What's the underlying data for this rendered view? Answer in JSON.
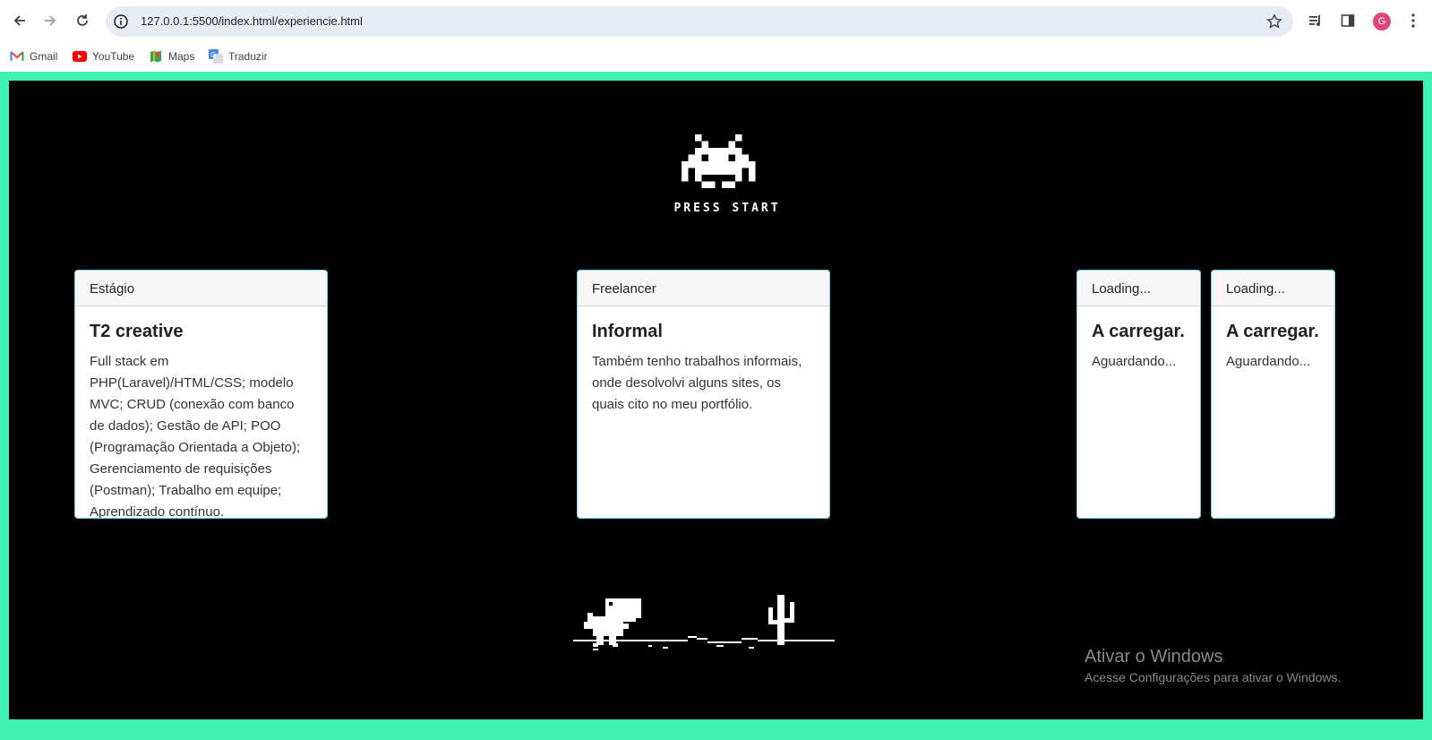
{
  "browser": {
    "url": "127.0.0.1:5500/index.html/experiencie.html",
    "avatar_letter": "G",
    "bookmarks": [
      {
        "label": "Gmail",
        "icon": "gmail-icon"
      },
      {
        "label": "YouTube",
        "icon": "youtube-icon"
      },
      {
        "label": "Maps",
        "icon": "maps-icon"
      },
      {
        "label": "Traduzir",
        "icon": "translate-icon"
      }
    ]
  },
  "hero": {
    "press_start": "PRESS START"
  },
  "cards": [
    {
      "header": "Estágio",
      "title": "T2 creative",
      "text": "Full stack em PHP(Laravel)/HTML/CSS; modelo MVC; CRUD (conexão com banco de dados); Gestão de API; POO (Programação Orientada a Objeto); Gerenciamento de requisições (Postman); Trabalho em equipe; Aprendizado contínuo."
    },
    {
      "header": "Freelancer",
      "title": "Informal",
      "text": "Também tenho trabalhos informais, onde desolvolvi alguns sites, os quais cito no meu portfólio."
    },
    {
      "header": "Loading...",
      "title": "A carregar...",
      "text": "Aguardando..."
    },
    {
      "header": "Loading...",
      "title": "A carregar...",
      "text": "Aguardando..."
    }
  ],
  "watermark": {
    "title": "Ativar o Windows",
    "subtitle": "Acesse Configurações para ativar o Windows."
  },
  "colors": {
    "page_border": "#3ff2b4",
    "stage": "#000000",
    "card_border": "#6fcfe8"
  }
}
